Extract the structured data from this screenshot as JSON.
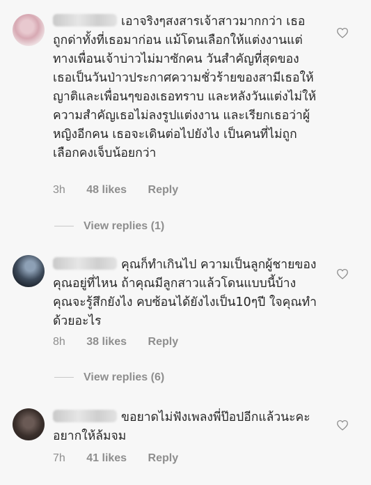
{
  "comments": [
    {
      "text": "เอาจริงๆสงสารเจ้าสาวมากกว่า เธอถูกด่าทั้งที่เธอมาก่อน แม้โดนเลือกให้แต่งงานแต่ทางเพื่อนเจ้าบ่าวไม่มาซักคน วันสำคัญที่สุดของเธอเป็นวันป่าวประกาศความชั่วร้ายของสามีเธอให้ญาติและเพื่อนๆของเธอทราบ และหลังวันแต่งไม่ให้ความสำคัญเธอไม่ลงรูปแต่งงาน และเรียกเธอว่าผู้หญิงอีกคน เธอจะเดินต่อไปยังไง เป็นคนที่ไม่ถูกเลือกคงเจ็บน้อยกว่า",
      "time": "3h",
      "likes": "48 likes",
      "reply": "Reply",
      "view_replies": "View replies (1)"
    },
    {
      "text": "คุณก็ทำเกินไป ความเป็นลูกผู้ชายของคุณอยู่ที่ไหน ถ้าคุณมีลูกสาวแล้วโดนแบบนี้บ้าง คุณจะรู้สึกยังไง คบซ้อนได้ยังไงเป็น10ๆปี ใจคุณทำด้วยอะไร",
      "time": "8h",
      "likes": "38 likes",
      "reply": "Reply",
      "view_replies": "View replies (6)"
    },
    {
      "text": "ขอยาดไม่ฟังเพลงพี่ป๊อปอีกแล้วนะคะ อยากให้ล้มจม",
      "time": "7h",
      "likes": "41 likes",
      "reply": "Reply"
    }
  ],
  "icons": {
    "like": "heart-outline-icon"
  }
}
